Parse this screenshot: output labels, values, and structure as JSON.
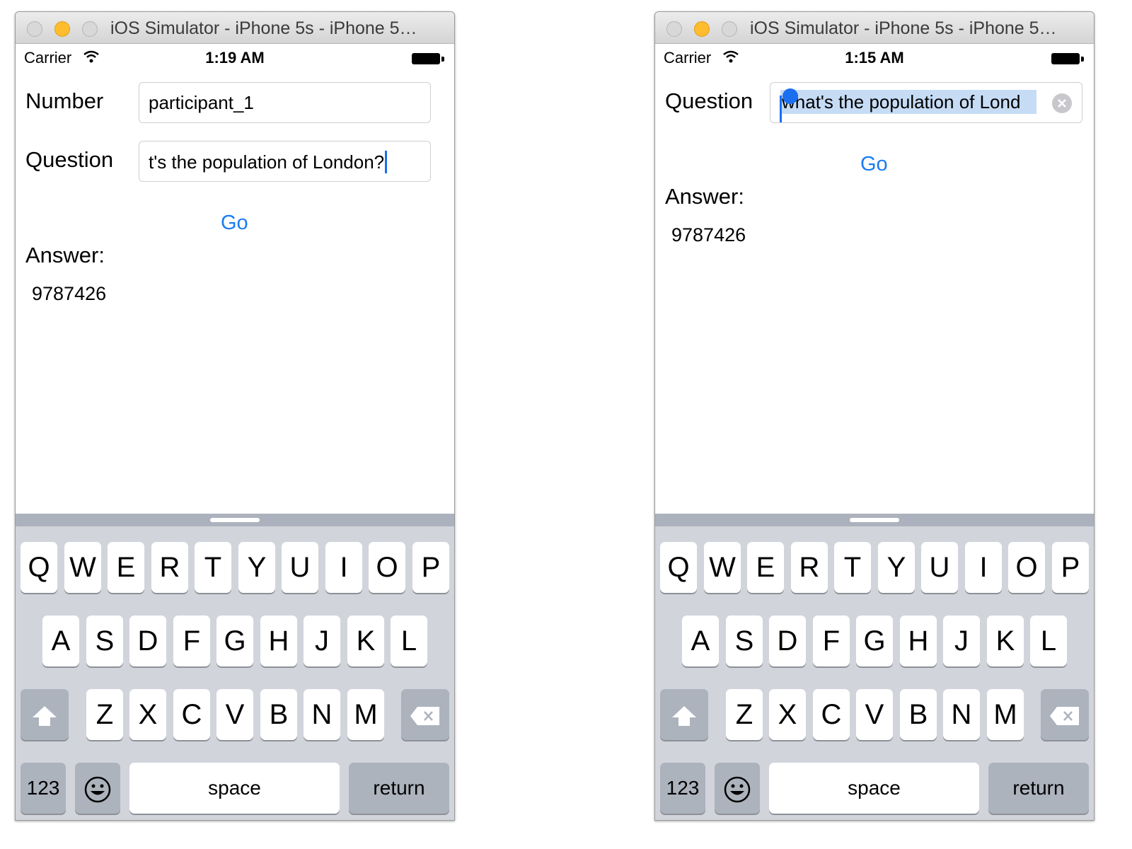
{
  "left": {
    "window_title": "iOS Simulator - iPhone 5s - iPhone 5…",
    "status": {
      "carrier": "Carrier",
      "time": "1:19 AM"
    },
    "number_label": "Number",
    "number_value": "participant_1",
    "question_label": "Question",
    "question_value": "t's the population of London?",
    "go_label": "Go",
    "answer_label": "Answer:",
    "answer_value": "9787426"
  },
  "right": {
    "window_title": "iOS Simulator - iPhone 5s - iPhone 5…",
    "status": {
      "carrier": "Carrier",
      "time": "1:15 AM"
    },
    "question_label": "Question",
    "question_value": "what's the population of Lond",
    "go_label": "Go",
    "answer_label": "Answer:",
    "answer_value": "9787426"
  },
  "keyboard": {
    "row1": [
      "Q",
      "W",
      "E",
      "R",
      "T",
      "Y",
      "U",
      "I",
      "O",
      "P"
    ],
    "row2": [
      "A",
      "S",
      "D",
      "F",
      "G",
      "H",
      "J",
      "K",
      "L"
    ],
    "row3": [
      "Z",
      "X",
      "C",
      "V",
      "B",
      "N",
      "M"
    ],
    "numbers_label": "123",
    "space_label": "space",
    "return_label": "return",
    "shift_icon": "shift-arrow-icon",
    "delete_icon": "backspace-icon",
    "emoji_icon": "emoji-face-icon"
  },
  "colors": {
    "accent_blue": "#1a7cf2",
    "selection": "#c6dcf5",
    "keyboard_bg": "#d1d5db"
  }
}
